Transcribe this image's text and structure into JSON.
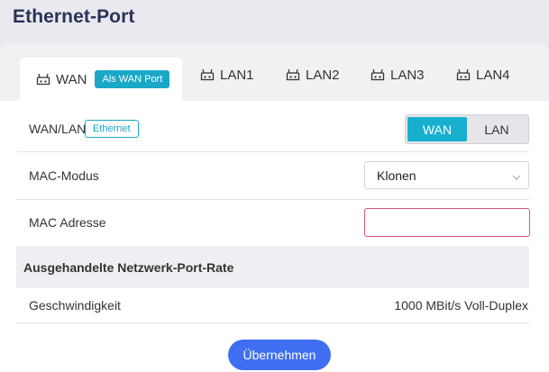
{
  "page": {
    "title": "Ethernet-Port"
  },
  "tabs": [
    {
      "label": "WAN",
      "badge": "Als WAN Port",
      "active": true
    },
    {
      "label": "LAN1",
      "active": false
    },
    {
      "label": "LAN2",
      "active": false
    },
    {
      "label": "LAN3",
      "active": false
    },
    {
      "label": "LAN4",
      "active": false
    }
  ],
  "tab_icon": "router-icon",
  "form": {
    "wanlan": {
      "label": "WAN/LAN",
      "badge": "Ethernet",
      "options": [
        "WAN",
        "LAN"
      ],
      "selected": "WAN"
    },
    "mac_mode": {
      "label": "MAC-Modus",
      "value": "Klonen"
    },
    "mac_address": {
      "label": "MAC Adresse",
      "value": "",
      "placeholder": ""
    }
  },
  "rate_section": {
    "title": "Ausgehandelte Netzwerk-Port-Rate",
    "speed_label": "Geschwindigkeit",
    "speed_value": "1000 MBit/s Voll-Duplex"
  },
  "apply_label": "Übernehmen",
  "colors": {
    "accent": "#19b0d0",
    "button": "#3f6ff0",
    "error_border": "#d9577a",
    "title": "#283357"
  }
}
